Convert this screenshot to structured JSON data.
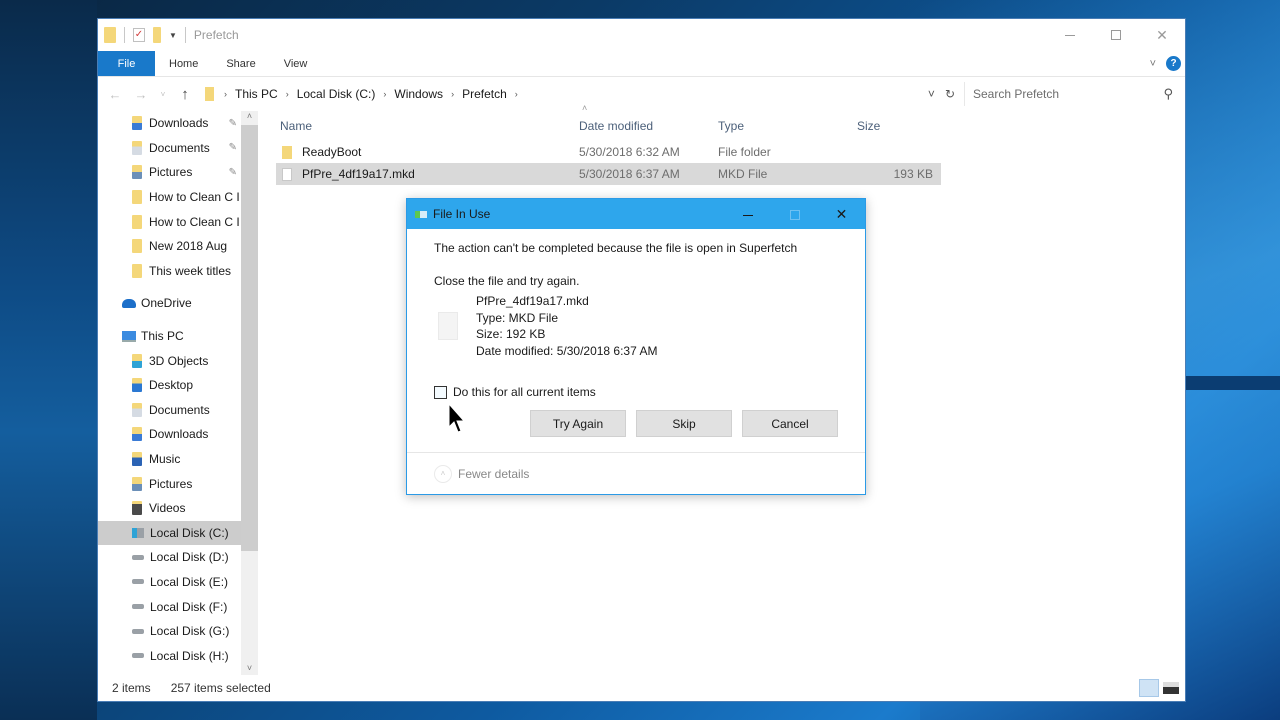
{
  "window": {
    "title": "Prefetch",
    "controls": {
      "minimize": "—",
      "maximize": "☐",
      "close": "✕"
    }
  },
  "ribbon": {
    "tabs": [
      {
        "label": "File",
        "active": true
      },
      {
        "label": "Home"
      },
      {
        "label": "Share"
      },
      {
        "label": "View"
      }
    ],
    "expand_icon": "˅",
    "help_icon": "?"
  },
  "navigation": {
    "back_icon": "←",
    "forward_icon": "→",
    "recent_icon": "˅",
    "up_icon": "↑",
    "breadcrumb": [
      "This PC",
      "Local Disk (C:)",
      "Windows",
      "Prefetch"
    ],
    "crumb_separator": "›",
    "dropdown_icon": "˅",
    "refresh_icon": "↻",
    "search_placeholder": "Search Prefetch",
    "search_icon": "⚲"
  },
  "nav_pane": {
    "quick_access": [
      {
        "label": "Downloads",
        "icon": "downloads-folder",
        "pinned": true
      },
      {
        "label": "Documents",
        "icon": "documents-folder",
        "pinned": true
      },
      {
        "label": "Pictures",
        "icon": "pictures-folder",
        "pinned": true
      },
      {
        "label": "How to Clean C I",
        "icon": "folder"
      },
      {
        "label": "How to Clean C I",
        "icon": "folder"
      },
      {
        "label": "New 2018 Aug",
        "icon": "folder"
      },
      {
        "label": "This week titles",
        "icon": "folder"
      }
    ],
    "onedrive": {
      "label": "OneDrive"
    },
    "this_pc": {
      "label": "This PC",
      "items": [
        {
          "label": "3D Objects"
        },
        {
          "label": "Desktop"
        },
        {
          "label": "Documents"
        },
        {
          "label": "Downloads"
        },
        {
          "label": "Music"
        },
        {
          "label": "Pictures"
        },
        {
          "label": "Videos"
        },
        {
          "label": "Local Disk (C:)",
          "selected": true
        },
        {
          "label": "Local Disk (D:)"
        },
        {
          "label": "Local Disk (E:)"
        },
        {
          "label": "Local Disk (F:)"
        },
        {
          "label": "Local Disk  (G:)"
        },
        {
          "label": "Local Disk (H:)"
        }
      ]
    },
    "pin_icon": "📌"
  },
  "file_list": {
    "columns": [
      "Name",
      "Date modified",
      "Type",
      "Size"
    ],
    "rows": [
      {
        "name": "ReadyBoot",
        "date": "5/30/2018 6:32 AM",
        "type": "File folder",
        "size": "",
        "selected": false
      },
      {
        "name": "PfPre_4df19a17.mkd",
        "date": "5/30/2018 6:37 AM",
        "type": "MKD File",
        "size": "193 KB",
        "selected": true
      }
    ]
  },
  "status_bar": {
    "item_count": "2 items",
    "selection": "257 items selected"
  },
  "dialog": {
    "title": "File In Use",
    "message": "The action can't be completed because the file is open in Superfetch",
    "instruction": "Close the file and try again.",
    "file": {
      "name": "PfPre_4df19a17.mkd",
      "type": "Type: MKD File",
      "size": "Size: 192 KB",
      "date": "Date modified: 5/30/2018 6:37 AM"
    },
    "checkbox_label": "Do this for all current items",
    "checkbox_checked": false,
    "buttons": {
      "try_again": "Try Again",
      "skip": "Skip",
      "cancel": "Cancel"
    },
    "fewer_details": "Fewer details",
    "controls": {
      "close": "✕"
    }
  },
  "colors": {
    "accent": "#1979ca",
    "dialog_title": "#2ea6ec",
    "selection": "#d9d9d9"
  }
}
